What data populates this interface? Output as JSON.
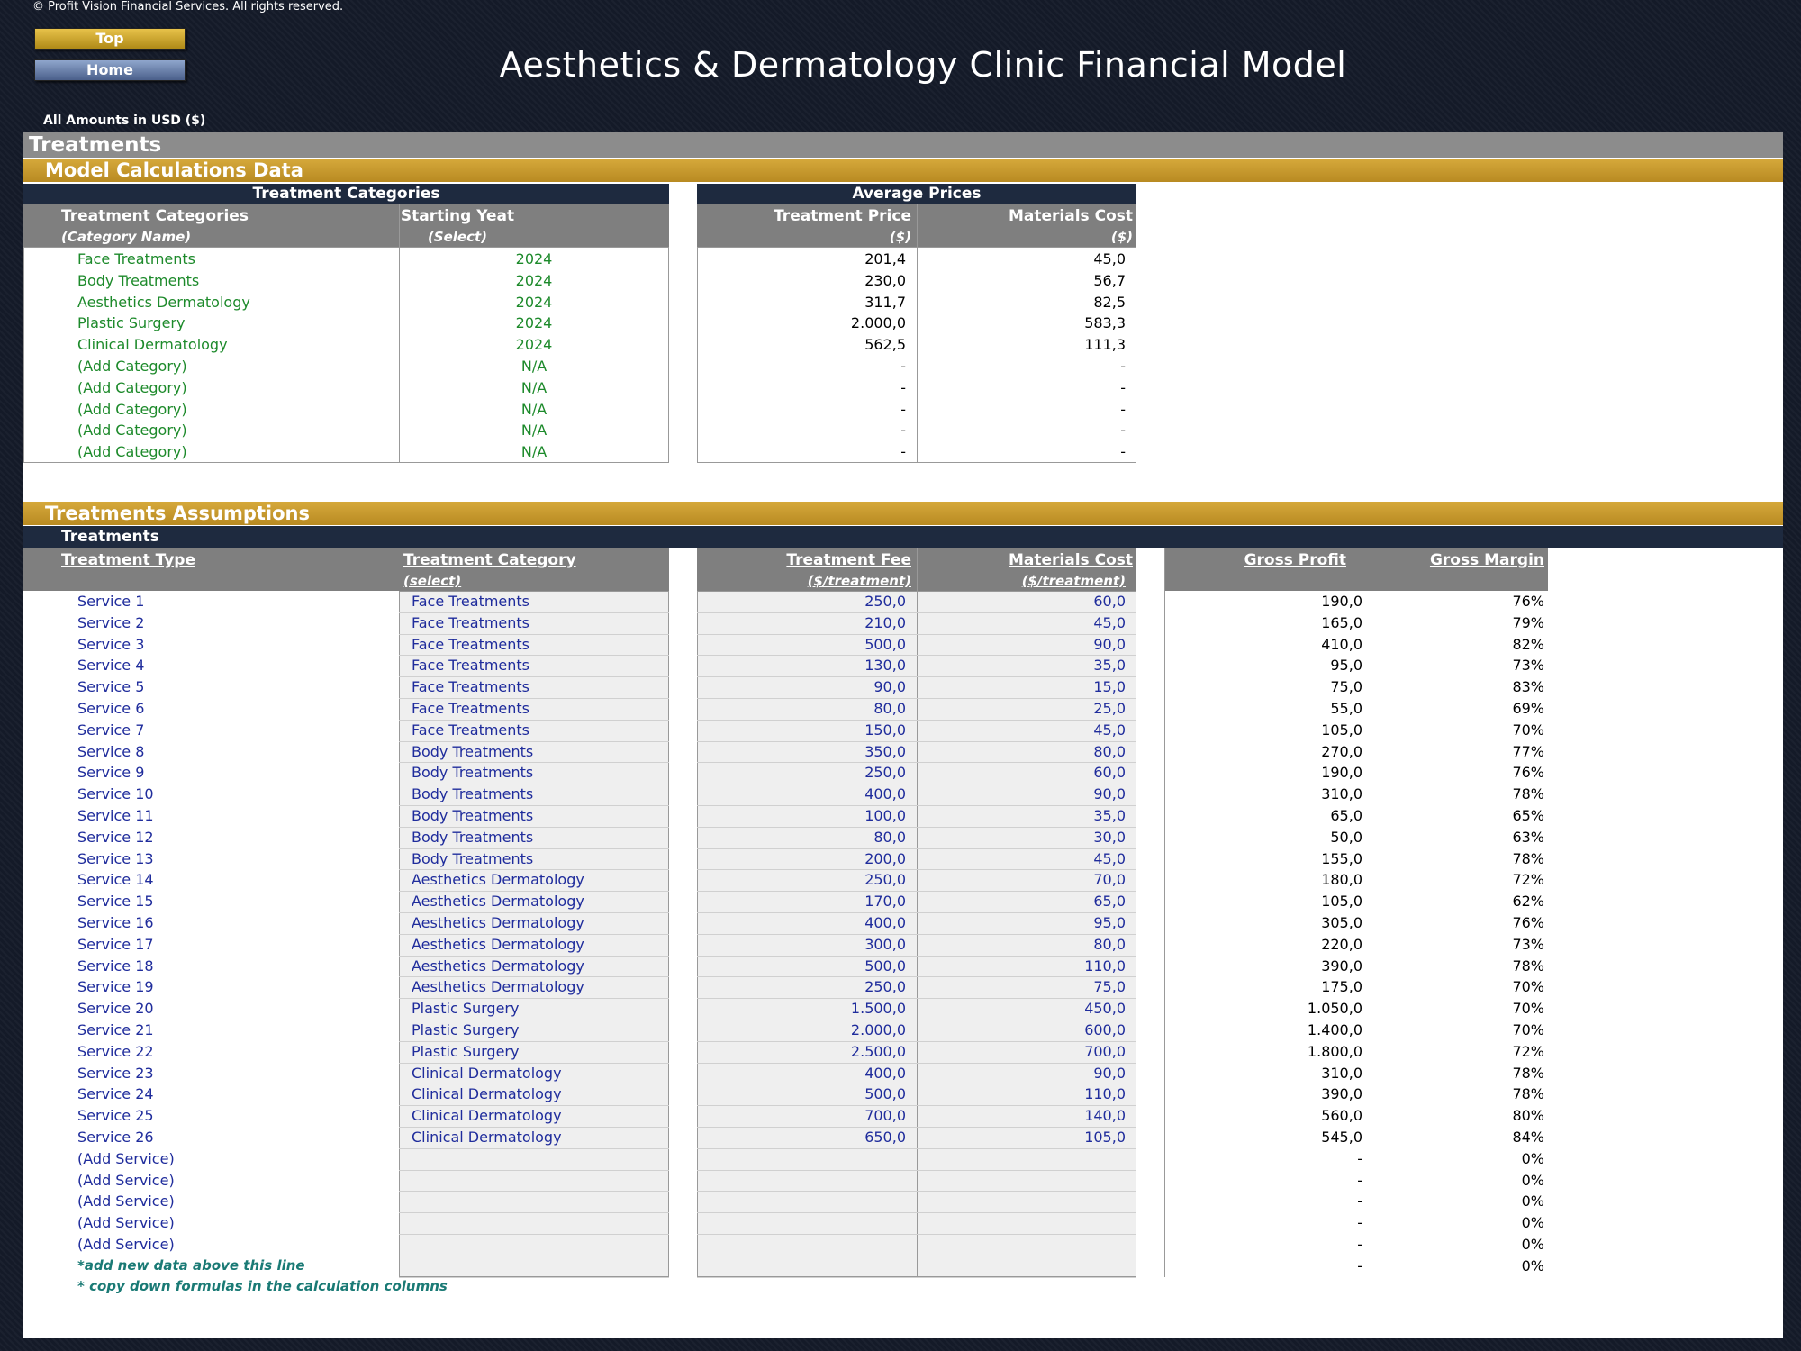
{
  "header": {
    "copyright": "© Profit Vision Financial Services. All rights reserved.",
    "top_button": "Top",
    "home_button": "Home",
    "title": "Aesthetics & Dermatology Clinic Financial Model",
    "amounts": "All Amounts in  USD ($)"
  },
  "sections": {
    "treatments": "Treatments",
    "model_calc": "Model Calculations Data",
    "assumptions": "Treatments Assumptions",
    "assumptions_sub": "Treatments"
  },
  "categories_table": {
    "bar_title": "Treatment Categories",
    "col1": "Treatment Categories",
    "col1_sub": "(Category Name)",
    "col2": "Starting Yeat",
    "col2_sub": "(Select)",
    "rows": [
      {
        "name": "Face Treatments",
        "year": "2024"
      },
      {
        "name": "Body Treatments",
        "year": "2024"
      },
      {
        "name": "Aesthetics Dermatology",
        "year": "2024"
      },
      {
        "name": "Plastic Surgery",
        "year": "2024"
      },
      {
        "name": "Clinical Dermatology",
        "year": "2024"
      },
      {
        "name": "(Add Category)",
        "year": "N/A"
      },
      {
        "name": "(Add Category)",
        "year": "N/A"
      },
      {
        "name": "(Add Category)",
        "year": "N/A"
      },
      {
        "name": "(Add Category)",
        "year": "N/A"
      },
      {
        "name": "(Add Category)",
        "year": "N/A"
      }
    ]
  },
  "prices_table": {
    "bar_title": "Average Prices",
    "col1": "Treatment Price",
    "col1_sub": "($)",
    "col2": "Materials Cost",
    "col2_sub": "($)",
    "rows": [
      {
        "price": "201,4",
        "cost": "45,0"
      },
      {
        "price": "230,0",
        "cost": "56,7"
      },
      {
        "price": "311,7",
        "cost": "82,5"
      },
      {
        "price": "2.000,0",
        "cost": "583,3"
      },
      {
        "price": "562,5",
        "cost": "111,3"
      },
      {
        "price": "-",
        "cost": "-"
      },
      {
        "price": "-",
        "cost": "-"
      },
      {
        "price": "-",
        "cost": "-"
      },
      {
        "price": "-",
        "cost": "-"
      },
      {
        "price": "-",
        "cost": "-"
      }
    ]
  },
  "services_table": {
    "col_type": "Treatment Type",
    "col_category": "Treatment Category",
    "col_category_sub": "(select)",
    "col_fee": "Treatment Fee",
    "col_fee_sub": "($/treatment)",
    "col_cost": "Materials Cost",
    "col_cost_sub": "($/treatment)",
    "col_profit": "Gross Profit",
    "col_margin": "Gross Margin",
    "rows": [
      {
        "type": "Service 1",
        "category": "Face Treatments",
        "fee": "250,0",
        "cost": "60,0",
        "profit": "190,0",
        "margin": "76%"
      },
      {
        "type": "Service 2",
        "category": "Face Treatments",
        "fee": "210,0",
        "cost": "45,0",
        "profit": "165,0",
        "margin": "79%"
      },
      {
        "type": "Service 3",
        "category": "Face Treatments",
        "fee": "500,0",
        "cost": "90,0",
        "profit": "410,0",
        "margin": "82%"
      },
      {
        "type": "Service 4",
        "category": "Face Treatments",
        "fee": "130,0",
        "cost": "35,0",
        "profit": "95,0",
        "margin": "73%"
      },
      {
        "type": "Service 5",
        "category": "Face Treatments",
        "fee": "90,0",
        "cost": "15,0",
        "profit": "75,0",
        "margin": "83%"
      },
      {
        "type": "Service 6",
        "category": "Face Treatments",
        "fee": "80,0",
        "cost": "25,0",
        "profit": "55,0",
        "margin": "69%"
      },
      {
        "type": "Service 7",
        "category": "Face Treatments",
        "fee": "150,0",
        "cost": "45,0",
        "profit": "105,0",
        "margin": "70%"
      },
      {
        "type": "Service 8",
        "category": "Body Treatments",
        "fee": "350,0",
        "cost": "80,0",
        "profit": "270,0",
        "margin": "77%"
      },
      {
        "type": "Service 9",
        "category": "Body Treatments",
        "fee": "250,0",
        "cost": "60,0",
        "profit": "190,0",
        "margin": "76%"
      },
      {
        "type": "Service 10",
        "category": "Body Treatments",
        "fee": "400,0",
        "cost": "90,0",
        "profit": "310,0",
        "margin": "78%"
      },
      {
        "type": "Service 11",
        "category": "Body Treatments",
        "fee": "100,0",
        "cost": "35,0",
        "profit": "65,0",
        "margin": "65%"
      },
      {
        "type": "Service 12",
        "category": "Body Treatments",
        "fee": "80,0",
        "cost": "30,0",
        "profit": "50,0",
        "margin": "63%"
      },
      {
        "type": "Service 13",
        "category": "Body Treatments",
        "fee": "200,0",
        "cost": "45,0",
        "profit": "155,0",
        "margin": "78%"
      },
      {
        "type": "Service 14",
        "category": "Aesthetics Dermatology",
        "fee": "250,0",
        "cost": "70,0",
        "profit": "180,0",
        "margin": "72%"
      },
      {
        "type": "Service 15",
        "category": "Aesthetics Dermatology",
        "fee": "170,0",
        "cost": "65,0",
        "profit": "105,0",
        "margin": "62%"
      },
      {
        "type": "Service 16",
        "category": "Aesthetics Dermatology",
        "fee": "400,0",
        "cost": "95,0",
        "profit": "305,0",
        "margin": "76%"
      },
      {
        "type": "Service 17",
        "category": "Aesthetics Dermatology",
        "fee": "300,0",
        "cost": "80,0",
        "profit": "220,0",
        "margin": "73%"
      },
      {
        "type": "Service 18",
        "category": "Aesthetics Dermatology",
        "fee": "500,0",
        "cost": "110,0",
        "profit": "390,0",
        "margin": "78%"
      },
      {
        "type": "Service 19",
        "category": "Aesthetics Dermatology",
        "fee": "250,0",
        "cost": "75,0",
        "profit": "175,0",
        "margin": "70%"
      },
      {
        "type": "Service 20",
        "category": "Plastic Surgery",
        "fee": "1.500,0",
        "cost": "450,0",
        "profit": "1.050,0",
        "margin": "70%"
      },
      {
        "type": "Service 21",
        "category": "Plastic Surgery",
        "fee": "2.000,0",
        "cost": "600,0",
        "profit": "1.400,0",
        "margin": "70%"
      },
      {
        "type": "Service 22",
        "category": "Plastic Surgery",
        "fee": "2.500,0",
        "cost": "700,0",
        "profit": "1.800,0",
        "margin": "72%"
      },
      {
        "type": "Service 23",
        "category": "Clinical Dermatology",
        "fee": "400,0",
        "cost": "90,0",
        "profit": "310,0",
        "margin": "78%"
      },
      {
        "type": "Service 24",
        "category": "Clinical Dermatology",
        "fee": "500,0",
        "cost": "110,0",
        "profit": "390,0",
        "margin": "78%"
      },
      {
        "type": "Service 25",
        "category": "Clinical Dermatology",
        "fee": "700,0",
        "cost": "140,0",
        "profit": "560,0",
        "margin": "80%"
      },
      {
        "type": "Service 26",
        "category": "Clinical Dermatology",
        "fee": "650,0",
        "cost": "105,0",
        "profit": "545,0",
        "margin": "84%"
      },
      {
        "type": "(Add Service)",
        "category": "",
        "fee": "",
        "cost": "",
        "profit": "-",
        "margin": "0%"
      },
      {
        "type": "(Add Service)",
        "category": "",
        "fee": "",
        "cost": "",
        "profit": "-",
        "margin": "0%"
      },
      {
        "type": "(Add Service)",
        "category": "",
        "fee": "",
        "cost": "",
        "profit": "-",
        "margin": "0%"
      },
      {
        "type": "(Add Service)",
        "category": "",
        "fee": "",
        "cost": "",
        "profit": "-",
        "margin": "0%"
      },
      {
        "type": "(Add Service)",
        "category": "",
        "fee": "",
        "cost": "",
        "profit": "-",
        "margin": "0%"
      },
      {
        "type": "*add new data above this line",
        "category": "",
        "fee": "",
        "cost": "",
        "profit": "-",
        "margin": "0%"
      }
    ],
    "footnote": "* copy down formulas in the calculation columns"
  }
}
